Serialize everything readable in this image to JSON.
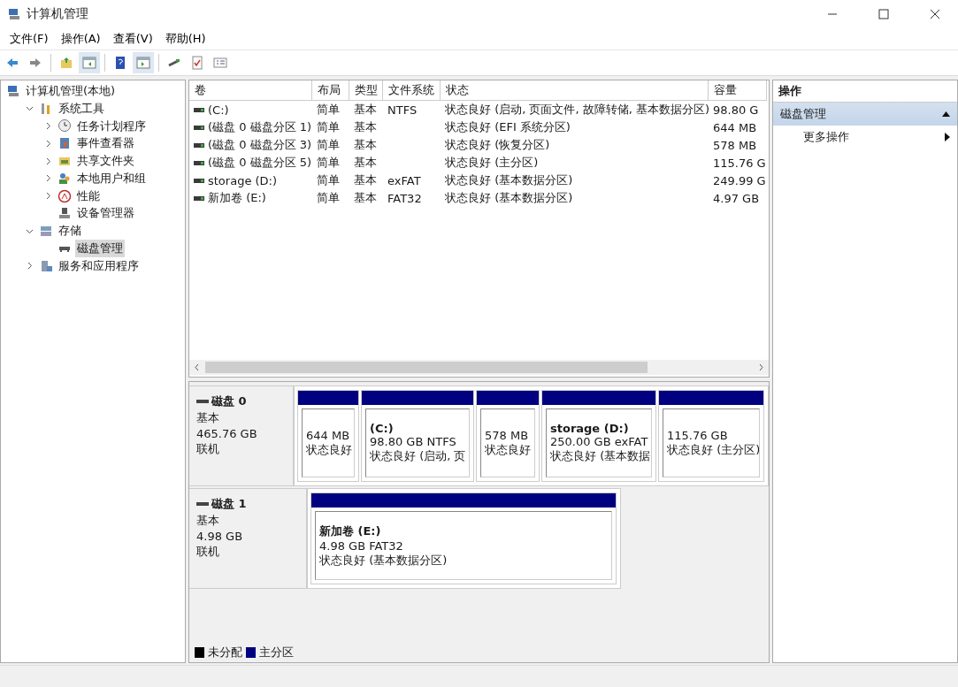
{
  "window": {
    "title": "计算机管理"
  },
  "menu": [
    "文件(F)",
    "操作(A)",
    "查看(V)",
    "帮助(H)"
  ],
  "tree": [
    {
      "label": "计算机管理(本地)",
      "kind": "root",
      "selected": false,
      "children": [
        {
          "label": "系统工具",
          "kind": "branch",
          "expanded": true,
          "selected": false,
          "children": [
            {
              "label": "任务计划程序",
              "kind": "branch",
              "expanded": false,
              "selected": false
            },
            {
              "label": "事件查看器",
              "kind": "branch",
              "expanded": false,
              "selected": false
            },
            {
              "label": "共享文件夹",
              "kind": "branch",
              "expanded": false,
              "selected": false
            },
            {
              "label": "本地用户和组",
              "kind": "branch",
              "expanded": false,
              "selected": false
            },
            {
              "label": "性能",
              "kind": "branch",
              "expanded": false,
              "selected": false
            },
            {
              "label": "设备管理器",
              "kind": "leaf",
              "expanded": false,
              "selected": false
            }
          ]
        },
        {
          "label": "存储",
          "kind": "branch",
          "expanded": true,
          "selected": false,
          "children": [
            {
              "label": "磁盘管理",
              "kind": "leaf",
              "expanded": false,
              "selected": true
            }
          ]
        },
        {
          "label": "服务和应用程序",
          "kind": "branch",
          "expanded": false,
          "selected": false
        }
      ]
    }
  ],
  "table": {
    "columns": [
      "卷",
      "布局",
      "类型",
      "文件系统",
      "状态",
      "容量"
    ],
    "rows": [
      {
        "cells": [
          "(C:)",
          "简单",
          "基本",
          "NTFS",
          "状态良好 (启动, 页面文件, 故障转储, 基本数据分区)",
          "98.80 G"
        ]
      },
      {
        "cells": [
          "(磁盘 0 磁盘分区 1)",
          "简单",
          "基本",
          "",
          "状态良好 (EFI 系统分区)",
          "644 MB"
        ]
      },
      {
        "cells": [
          "(磁盘 0 磁盘分区 3)",
          "简单",
          "基本",
          "",
          "状态良好 (恢复分区)",
          "578 MB"
        ]
      },
      {
        "cells": [
          "(磁盘 0 磁盘分区 5)",
          "简单",
          "基本",
          "",
          "状态良好 (主分区)",
          "115.76 G"
        ]
      },
      {
        "cells": [
          "storage (D:)",
          "简单",
          "基本",
          "exFAT",
          "状态良好 (基本数据分区)",
          "249.99 G"
        ]
      },
      {
        "cells": [
          "新加卷 (E:)",
          "简单",
          "基本",
          "FAT32",
          "状态良好 (基本数据分区)",
          "4.97 GB"
        ]
      }
    ]
  },
  "disks": [
    {
      "name": "磁盘 0",
      "type": "基本",
      "size": "465.76 GB",
      "status": "联机",
      "partitions": [
        {
          "size": "644 MB",
          "status": "状态良好",
          "kind": "primary"
        },
        {
          "title": "(C:)",
          "size": "98.80 GB NTFS",
          "status": "状态良好 (启动, 页",
          "kind": "primary"
        },
        {
          "size": "578 MB",
          "status": "状态良好",
          "kind": "primary"
        },
        {
          "title": "storage  (D:)",
          "size": "250.00 GB exFAT",
          "status": "状态良好 (基本数据",
          "kind": "primary"
        },
        {
          "size": "115.76 GB",
          "status": "状态良好 (主分区)",
          "kind": "primary"
        }
      ]
    },
    {
      "name": "磁盘 1",
      "type": "基本",
      "size": "4.98 GB",
      "status": "联机",
      "partitions": [
        {
          "title": "新加卷  (E:)",
          "size": "4.98 GB FAT32",
          "status": "状态良好 (基本数据分区)",
          "kind": "primary"
        }
      ]
    }
  ],
  "legend": [
    {
      "label": "未分配",
      "color": "#000000"
    },
    {
      "label": "主分区",
      "color": "#000080"
    }
  ],
  "actions": {
    "title": "操作",
    "groups": [
      {
        "label": "磁盘管理",
        "selected": true,
        "items": [
          "更多操作"
        ]
      }
    ]
  }
}
